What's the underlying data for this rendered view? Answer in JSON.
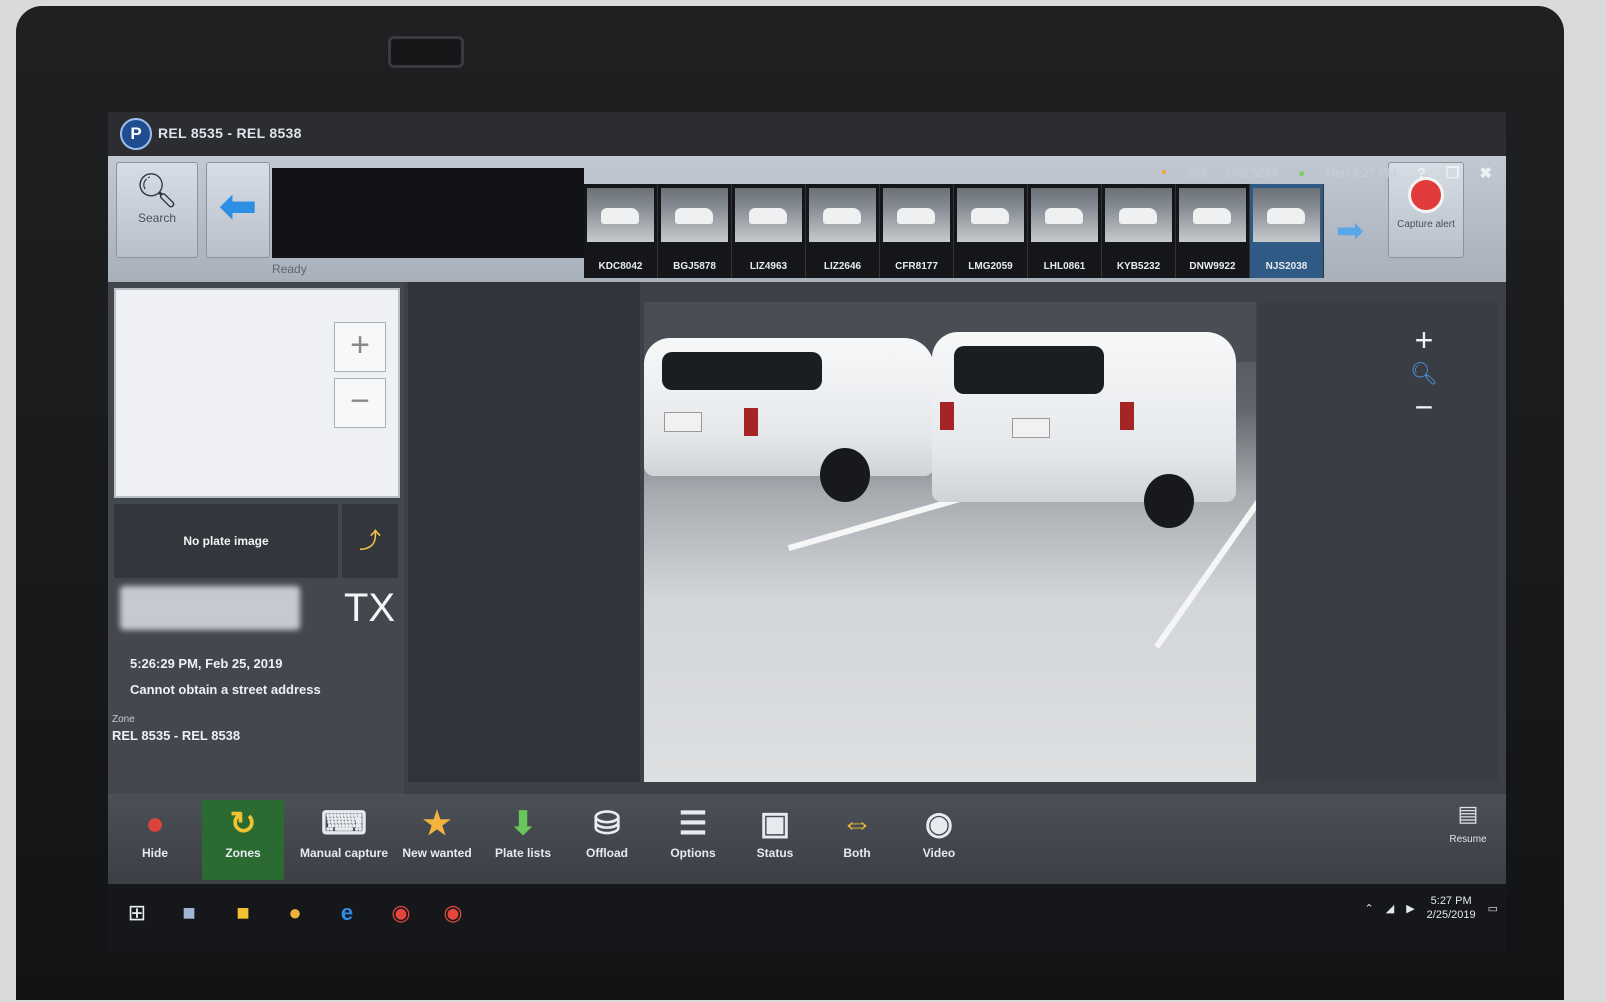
{
  "window": {
    "logo": "P",
    "title": "REL 8535 - REL 8538"
  },
  "status": {
    "count": "399",
    "unit": "Unit 5254",
    "datetime": "Mon 5:27 PM",
    "help": "?"
  },
  "toolbar": {
    "search_label": "Search",
    "ready_label": "Ready",
    "record_label": "Capture alert"
  },
  "thumbnails": [
    {
      "plate": "KDC8042"
    },
    {
      "plate": "BGJ5878"
    },
    {
      "plate": "LIZ4963"
    },
    {
      "plate": "LIZ2646"
    },
    {
      "plate": "CFR8177"
    },
    {
      "plate": "LMG2059"
    },
    {
      "plate": "LHL0861"
    },
    {
      "plate": "KYB5232"
    },
    {
      "plate": "DNW9922"
    },
    {
      "plate": "NJS2038",
      "selected": true
    }
  ],
  "read": {
    "no_plate_text": "No plate image",
    "state": "TX",
    "timestamp": "5:26:29 PM, Feb 25, 2019",
    "address": "Cannot obtain a street address",
    "zone_label": "Zone",
    "zone_value": "REL 8535 - REL 8538"
  },
  "appbar": {
    "hide": "Hide",
    "zones": "Zones",
    "manual_capture": "Manual capture",
    "new_wanted": "New wanted",
    "plate_lists": "Plate lists",
    "offload": "Offload",
    "options": "Options",
    "status": "Status",
    "both": "Both",
    "video": "Video",
    "resume": "Resume"
  },
  "taskbar": {
    "time": "5:27 PM",
    "date": "2/25/2019"
  },
  "colors": {
    "accent_blue": "#2c8fe3",
    "active_green": "#2b6b32",
    "record_red": "#e23b3b"
  }
}
